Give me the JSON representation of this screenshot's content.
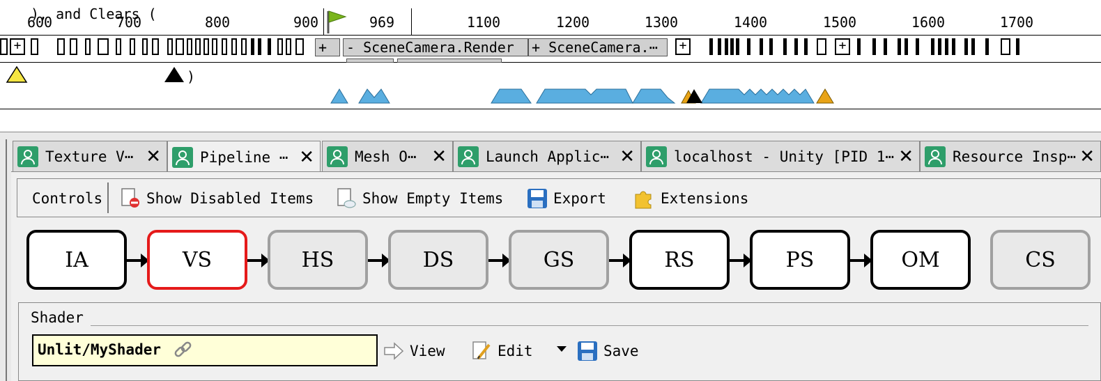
{
  "timeline": {
    "ticks": [
      {
        "label": "600"
      },
      {
        "label": "700"
      },
      {
        "label": "800"
      },
      {
        "label": "900"
      },
      {
        "label": "969"
      },
      {
        "label": "1100"
      },
      {
        "label": "1200"
      },
      {
        "label": "1300"
      },
      {
        "label": "1400"
      },
      {
        "label": "1500"
      },
      {
        "label": "1600"
      },
      {
        "label": "1700"
      }
    ],
    "current_event": "969",
    "event_blocks": [
      {
        "label": "- SceneCamera.Render"
      },
      {
        "label": "+ SceneCamera.⋯"
      }
    ],
    "plus_label": "+",
    "legend_text": "), and Clears (",
    "legend_close": ")",
    "marker_colors": {
      "draw": "#5aaee0",
      "clear": "#000000",
      "action": "#e8a317",
      "legend_warn": "#f5e642"
    }
  },
  "tabs": [
    {
      "label": "Texture V⋯",
      "close": "✕"
    },
    {
      "label": "Pipeline ⋯",
      "close": "✕"
    },
    {
      "label": "Mesh O⋯",
      "close": "✕"
    },
    {
      "label": "Launch Applic⋯",
      "close": "✕"
    },
    {
      "label": "localhost - Unity [PID 1⋯",
      "close": "✕"
    },
    {
      "label": "Resource Insp⋯",
      "close": "✕"
    }
  ],
  "toolbar": {
    "controls_label": "Controls",
    "show_disabled": "Show Disabled Items",
    "show_empty": "Show Empty Items",
    "export": "Export",
    "extensions": "Extensions"
  },
  "pipeline": {
    "stages": [
      {
        "label": "IA",
        "state": "enabled"
      },
      {
        "label": "VS",
        "state": "selected"
      },
      {
        "label": "HS",
        "state": "disabled"
      },
      {
        "label": "DS",
        "state": "disabled"
      },
      {
        "label": "GS",
        "state": "disabled"
      },
      {
        "label": "RS",
        "state": "enabled"
      },
      {
        "label": "PS",
        "state": "enabled"
      },
      {
        "label": "OM",
        "state": "enabled"
      },
      {
        "label": "CS",
        "state": "disabled"
      }
    ],
    "selected_color": "#e51a1a"
  },
  "shader": {
    "group_title": "Shader",
    "name": "Unlit/MyShader",
    "view": "View",
    "edit": "Edit",
    "save": "Save"
  }
}
